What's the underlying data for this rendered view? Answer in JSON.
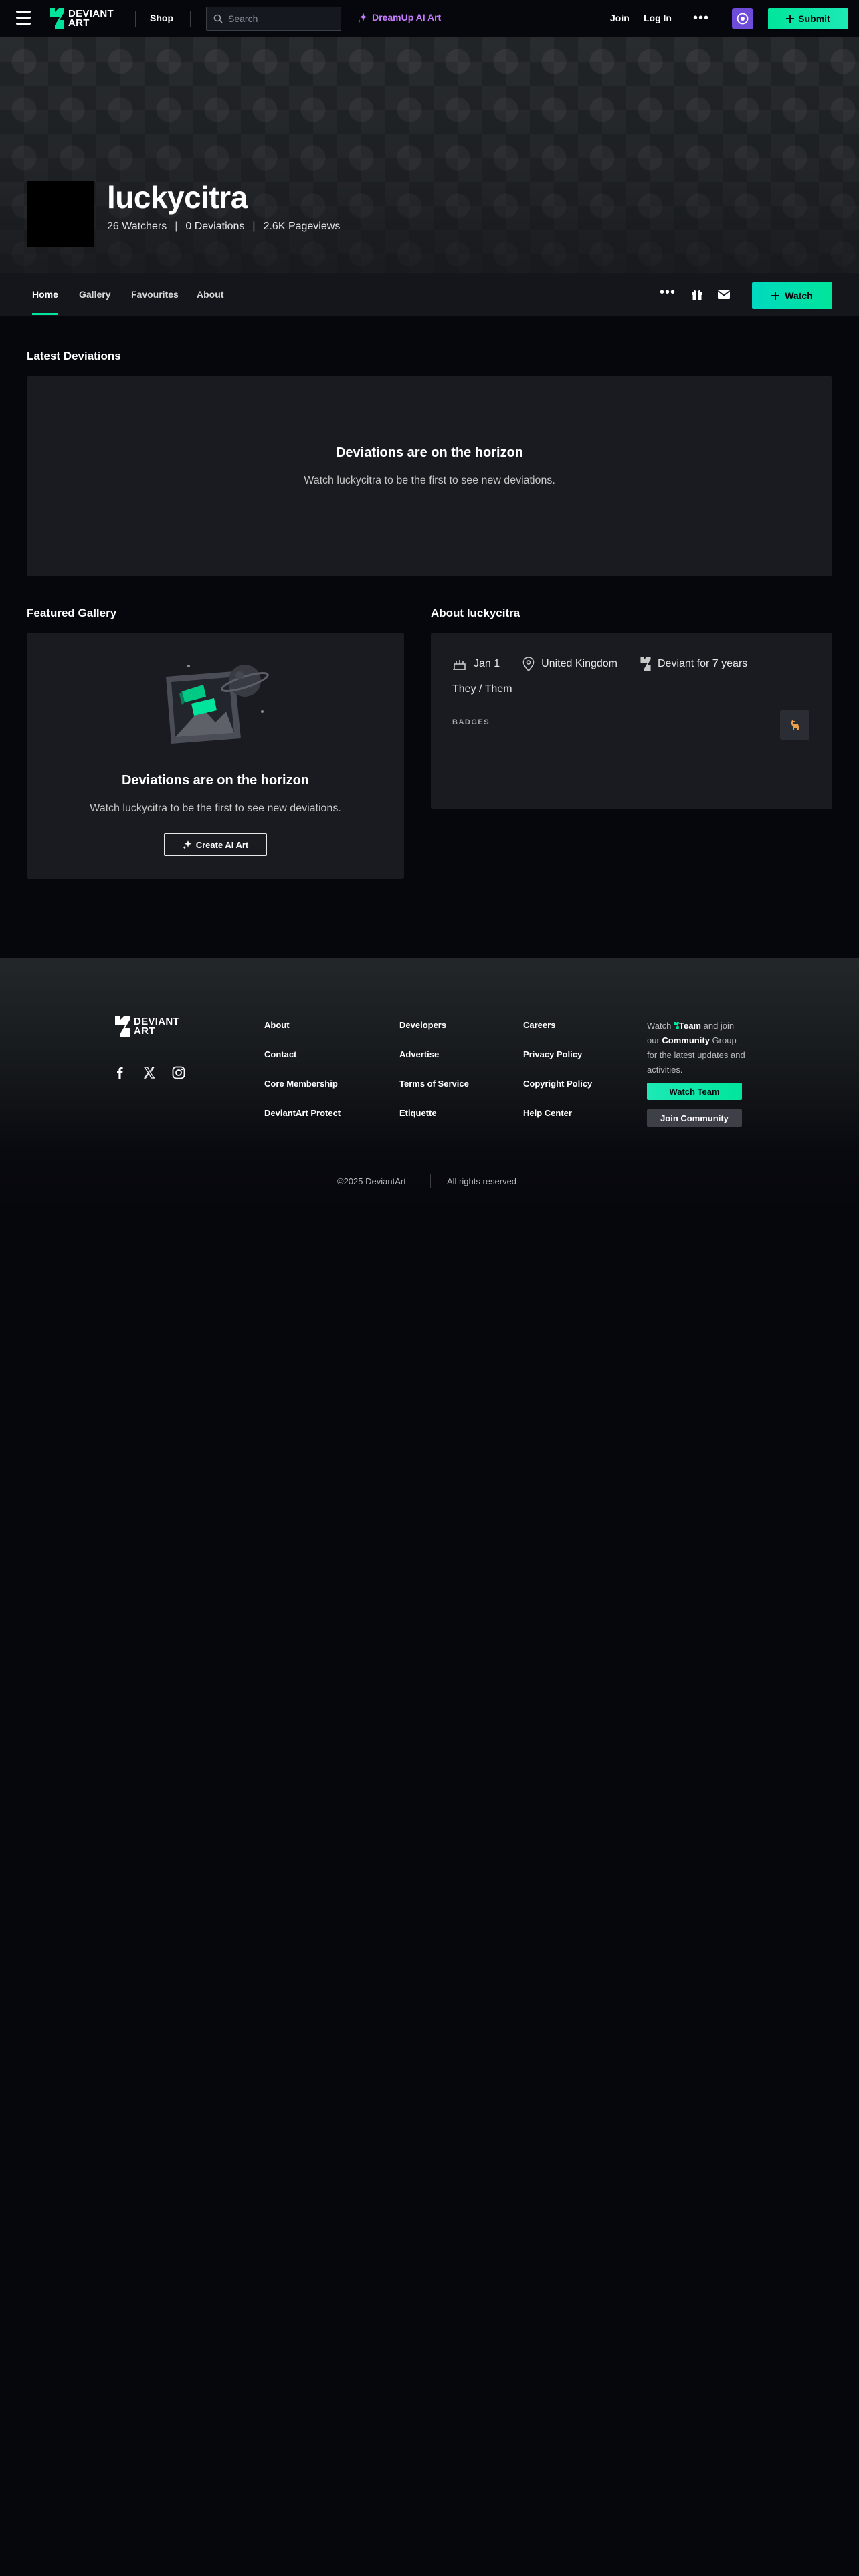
{
  "topbar": {
    "logo_text_line1": "DEVIANT",
    "logo_text_line2": "ART",
    "shop_label": "Shop",
    "search_placeholder": "Search",
    "dreamup_label": "DreamUp AI Art",
    "join_label": "Join",
    "login_label": "Log In",
    "more_label": "•••",
    "submit_label": "Submit"
  },
  "profile": {
    "username": "luckycitra",
    "watchers": "26 Watchers",
    "deviations": "0 Deviations",
    "pageviews": "2.6K Pageviews",
    "separator": "|"
  },
  "profile_nav": {
    "tabs": [
      {
        "label": "Home",
        "active": true
      },
      {
        "label": "Gallery"
      },
      {
        "label": "Favourites"
      },
      {
        "label": "About"
      }
    ],
    "more_label": "•••",
    "watch_label": "Watch"
  },
  "latest": {
    "title": "Latest Deviations",
    "heading": "Deviations are on the horizon",
    "subtext": "Watch luckycitra to be the first to see new deviations."
  },
  "featured": {
    "title": "Featured Gallery",
    "heading": "Deviations are on the horizon",
    "subtext": "Watch luckycitra to be the first to see new deviations.",
    "create_label": "Create AI Art"
  },
  "about": {
    "title": "About luckycitra",
    "birthday": "Jan 1",
    "location": "United Kingdom",
    "member_for": "Deviant for 7 years",
    "pronouns": "They / Them",
    "badges_label": "BADGES"
  },
  "footer": {
    "logo_text_line1": "DEVIANT",
    "logo_text_line2": "ART",
    "col1": [
      "About",
      "Contact",
      "Core Membership",
      "DeviantArt Protect"
    ],
    "col2": [
      "Developers",
      "Advertise",
      "Terms of Service",
      "Etiquette"
    ],
    "col3": [
      "Careers",
      "Privacy Policy",
      "Copyright Policy",
      "Help Center"
    ],
    "blurb": {
      "watch": "Watch",
      "team": "Team",
      "and": "and join our",
      "community": "Community",
      "rest": "Group for the latest updates and activities."
    },
    "watch_team_label": "Watch Team",
    "join_community_label": "Join Community",
    "copyright": "©2025 DeviantArt",
    "rights": "All rights reserved"
  },
  "colors": {
    "accent": "#00e59b",
    "dreamup": "#c77dff",
    "background": "#06070d",
    "card": "#191b21"
  }
}
